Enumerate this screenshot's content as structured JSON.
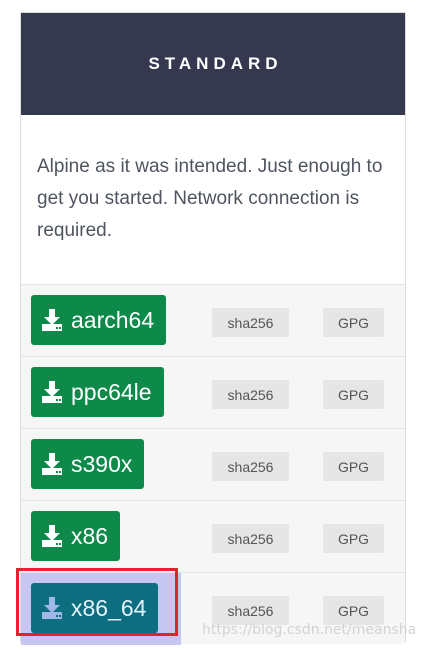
{
  "card": {
    "title": "STANDARD",
    "description": "Alpine as it was intended. Just enough to get you started. Network connection is required."
  },
  "downloads": [
    {
      "label": "aarch64",
      "sha_label": "sha256",
      "gpg_label": "GPG"
    },
    {
      "label": "ppc64le",
      "sha_label": "sha256",
      "gpg_label": "GPG"
    },
    {
      "label": "s390x",
      "sha_label": "sha256",
      "gpg_label": "GPG"
    },
    {
      "label": "x86",
      "sha_label": "sha256",
      "gpg_label": "GPG"
    },
    {
      "label": "x86_64",
      "sha_label": "sha256",
      "gpg_label": "GPG",
      "highlighted": true
    }
  ],
  "icons": {
    "download": "download-icon"
  },
  "colors": {
    "header_bg": "#363850",
    "download_button": "#0d8a4a",
    "selected_button": "#0c6e7e",
    "highlight_box": "#e5212f"
  },
  "watermark": "https://blog.csdn.net/meansha"
}
